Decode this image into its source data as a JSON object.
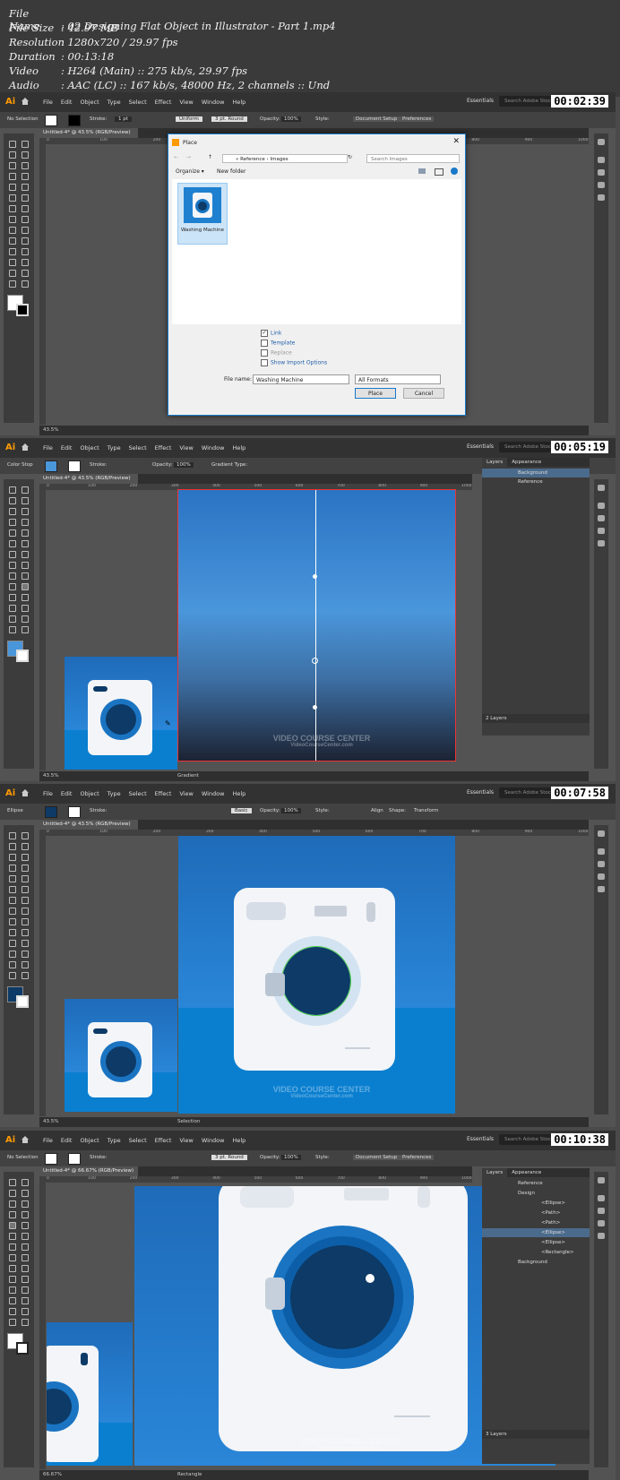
{
  "file_info": [
    {
      "key": "File Name",
      "value": "02 Designing Flat Object in Illustrator - Part 1.mp4"
    },
    {
      "key": "File Size",
      "value": "42.97 MB"
    },
    {
      "key": "Resolution",
      "value": "1280x720 / 29.97 fps"
    },
    {
      "key": "Duration",
      "value": "00:13:18"
    },
    {
      "key": "Video",
      "value": "H264 (Main) :: 275 kb/s, 29.97 fps"
    },
    {
      "key": "Audio",
      "value": "AAC (LC) :: 167 kb/s, 48000 Hz, 2 channels :: Und"
    }
  ],
  "app": {
    "logo": "Ai",
    "menus": [
      "File",
      "Edit",
      "Object",
      "Type",
      "Select",
      "Effect",
      "View",
      "Window",
      "Help"
    ],
    "workspace": "Essentials",
    "search_placeholder": "Search Adobe Stock",
    "watermark_line1": "VIDEO COURSE CENTER",
    "watermark_line2": "VideoCourseCenter.com"
  },
  "ruler_ticks": [
    "0",
    "100",
    "200",
    "300",
    "400",
    "500",
    "600",
    "700",
    "800",
    "900",
    "1000"
  ],
  "frames": [
    {
      "timestamp": "00:02:39",
      "tab": "Untitled-4* @ 43.5% (RGB/Preview)",
      "zoom": "43.5%",
      "status_tool": "",
      "control": {
        "left_label": "No Selection",
        "stroke_label": "Stroke:",
        "stroke_value": "1 pt",
        "uniform": "Uniform",
        "brush": "3 pt. Round",
        "opacity_label": "Opacity:",
        "opacity_value": "100%",
        "style_label": "Style:",
        "doc_setup": "Document Setup",
        "prefs": "Preferences"
      }
    },
    {
      "timestamp": "00:05:19",
      "tab": "Untitled-4* @ 43.5% (RGB/Preview)",
      "zoom": "43.5%",
      "status_tool": "Gradient",
      "control": {
        "left_label": "Color Stop",
        "stroke_label": "Stroke:",
        "opacity_label": "Opacity:",
        "opacity_value": "100%",
        "gradient_type": "Gradient Type:"
      }
    },
    {
      "timestamp": "00:07:58",
      "tab": "Untitled-4* @ 43.5% (RGB/Preview)",
      "zoom": "43.5%",
      "status_tool": "Selection",
      "control": {
        "left_label": "Ellipse",
        "stroke_label": "Stroke:",
        "basic": "Basic",
        "opacity_label": "Opacity:",
        "opacity_value": "100%",
        "style_label": "Style:",
        "align": "Align",
        "shape": "Shape:",
        "transform": "Transform"
      }
    },
    {
      "timestamp": "00:10:38",
      "tab": "Untitled-4* @ 66.67% (RGB/Preview)",
      "zoom": "66.67%",
      "status_tool": "Rectangle",
      "control": {
        "left_label": "No Selection",
        "stroke_label": "Stroke:",
        "brush": "3 pt. Round",
        "opacity_label": "Opacity:",
        "opacity_value": "100%",
        "style_label": "Style:",
        "doc_setup": "Document Setup",
        "prefs": "Preferences"
      }
    }
  ],
  "place_dialog": {
    "title": "Place",
    "breadcrumb": "« Reference › Images",
    "search": "Search Images",
    "organize": "Organize ▾",
    "new_folder": "New folder",
    "file_label": "Washing Machine",
    "options": [
      {
        "label": "Link",
        "checked": true
      },
      {
        "label": "Template",
        "checked": false
      },
      {
        "label": "Replace",
        "checked": false
      },
      {
        "label": "Show Import Options",
        "checked": false
      }
    ],
    "file_name_label": "File name:",
    "file_name": "Washing Machine",
    "format": "All Formats",
    "place_btn": "Place",
    "cancel_btn": "Cancel"
  },
  "layers_frame2": {
    "tabs": [
      "Layers",
      "Appearance"
    ],
    "layers": [
      "Background",
      "Reference"
    ],
    "count": "2 Layers"
  },
  "layers_frame4": {
    "tabs": [
      "Layers",
      "Appearance"
    ],
    "layers": [
      "Reference",
      "Design",
      "<Ellipse>",
      "<Path>",
      "<Path>",
      "<Ellipse>",
      "<Ellipse>",
      "<Rectangle>",
      "Background"
    ],
    "count": "3 Layers"
  },
  "colors": {
    "accent": "#1b79c9",
    "sky_top": "#2a74c4",
    "sky_mid": "#4a96db",
    "night": "#1c2333",
    "door_dark": "#0d3a66",
    "door_ring": "#1a74c2",
    "sea": "#0a7fd0"
  }
}
